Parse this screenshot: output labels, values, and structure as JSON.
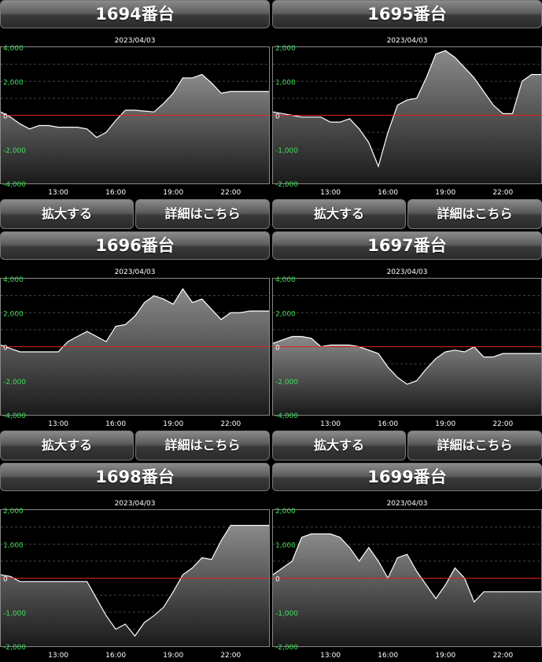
{
  "buttons": {
    "zoom": "拡大する",
    "detail": "詳細はこちら"
  },
  "colors": {
    "zero_line": "#e02020",
    "series_line": "#ffffff",
    "y_label_pos": "#3fe05a",
    "y_label_zero": "#ffffff",
    "grid": "#444444",
    "border": "#888888"
  },
  "chart_data": [
    {
      "type": "area",
      "title": "1694番台",
      "subtitle": "2023/04/03",
      "x_ticks": [
        "13:00",
        "16:00",
        "19:00",
        "22:00"
      ],
      "y_ticks": [
        "4,000",
        "2,000",
        "0",
        "-2,000",
        "-4,000"
      ],
      "ylim": [
        -4000,
        4000
      ],
      "x": [
        10,
        10.5,
        11,
        11.5,
        12,
        12.5,
        13,
        13.5,
        14,
        14.5,
        15,
        15.5,
        16,
        16.5,
        17,
        17.5,
        18,
        18.5,
        19,
        19.5,
        20,
        20.5,
        21,
        21.5,
        22,
        22.5,
        23,
        23.5,
        24
      ],
      "values": [
        200,
        -100,
        -500,
        -800,
        -600,
        -600,
        -700,
        -700,
        -700,
        -800,
        -1300,
        -1000,
        -300,
        300,
        300,
        250,
        200,
        700,
        1300,
        2200,
        2200,
        2400,
        1900,
        1300,
        1400,
        1400,
        1400,
        1400,
        1400
      ]
    },
    {
      "type": "area",
      "title": "1695番台",
      "subtitle": "2023/04/03",
      "x_ticks": [
        "13:00",
        "16:00",
        "19:00",
        "22:00"
      ],
      "y_ticks": [
        "2,000",
        "1,000",
        "0",
        "-1,000",
        "-2,000"
      ],
      "ylim": [
        -2000,
        2000
      ],
      "x": [
        10,
        10.5,
        11,
        11.5,
        12,
        12.5,
        13,
        13.5,
        14,
        14.5,
        15,
        15.5,
        16,
        16.5,
        17,
        17.5,
        18,
        18.5,
        19,
        19.5,
        20,
        20.5,
        21,
        21.5,
        22,
        22.5,
        23,
        23.5,
        24
      ],
      "values": [
        100,
        50,
        0,
        -50,
        -50,
        -50,
        -200,
        -200,
        -100,
        -400,
        -800,
        -1500,
        -500,
        300,
        450,
        500,
        1100,
        1800,
        1900,
        1700,
        1400,
        1100,
        700,
        300,
        50,
        50,
        1000,
        1200,
        1200
      ]
    },
    {
      "type": "area",
      "title": "1696番台",
      "subtitle": "2023/04/03",
      "x_ticks": [
        "13:00",
        "16:00",
        "19:00",
        "22:00"
      ],
      "y_ticks": [
        "4,000",
        "2,000",
        "0",
        "-2,000",
        "-4,000"
      ],
      "ylim": [
        -4000,
        4000
      ],
      "x": [
        10,
        10.5,
        11,
        11.5,
        12,
        12.5,
        13,
        13.5,
        14,
        14.5,
        15,
        15.5,
        16,
        16.5,
        17,
        17.5,
        18,
        18.5,
        19,
        19.5,
        20,
        20.5,
        21,
        21.5,
        22,
        22.5,
        23,
        23.5,
        24
      ],
      "values": [
        100,
        -100,
        -300,
        -300,
        -300,
        -300,
        -300,
        300,
        600,
        900,
        600,
        300,
        1200,
        1300,
        1800,
        2600,
        3000,
        2800,
        2500,
        3400,
        2600,
        2800,
        2200,
        1600,
        2000,
        2000,
        2100,
        2100,
        2100
      ]
    },
    {
      "type": "area",
      "title": "1697番台",
      "subtitle": "2023/04/03",
      "x_ticks": [
        "13:00",
        "16:00",
        "19:00",
        "22:00"
      ],
      "y_ticks": [
        "4,000",
        "2,000",
        "0",
        "-2,000",
        "-4,000"
      ],
      "ylim": [
        -4000,
        4000
      ],
      "x": [
        10,
        10.5,
        11,
        11.5,
        12,
        12.5,
        13,
        13.5,
        14,
        14.5,
        15,
        15.5,
        16,
        16.5,
        17,
        17.5,
        18,
        18.5,
        19,
        19.5,
        20,
        20.5,
        21,
        21.5,
        22,
        22.5,
        23,
        23.5,
        24
      ],
      "values": [
        200,
        400,
        600,
        600,
        500,
        0,
        100,
        100,
        100,
        0,
        -200,
        -400,
        -1200,
        -1800,
        -2200,
        -2000,
        -1300,
        -700,
        -300,
        -200,
        -300,
        0,
        -600,
        -600,
        -400,
        -400,
        -400,
        -400,
        -400
      ]
    },
    {
      "type": "area",
      "title": "1698番台",
      "subtitle": "2023/04/03",
      "x_ticks": [
        "13:00",
        "16:00",
        "19:00",
        "22:00"
      ],
      "y_ticks": [
        "2,000",
        "1,000",
        "0",
        "-1,000",
        "-2,000"
      ],
      "ylim": [
        -2000,
        2000
      ],
      "x": [
        10,
        10.5,
        11,
        11.5,
        12,
        12.5,
        13,
        13.5,
        14,
        14.5,
        15,
        15.5,
        16,
        16.5,
        17,
        17.5,
        18,
        18.5,
        19,
        19.5,
        20,
        20.5,
        21,
        21.5,
        22,
        22.5,
        23,
        23.5,
        24
      ],
      "values": [
        100,
        50,
        -100,
        -100,
        -100,
        -100,
        -100,
        -100,
        -100,
        -100,
        -600,
        -1100,
        -1500,
        -1350,
        -1700,
        -1300,
        -1100,
        -850,
        -400,
        100,
        300,
        600,
        550,
        1100,
        1550,
        1550,
        1550,
        1550,
        1550
      ]
    },
    {
      "type": "area",
      "title": "1699番台",
      "subtitle": "2023/04/03",
      "x_ticks": [
        "13:00",
        "16:00",
        "19:00",
        "22:00"
      ],
      "y_ticks": [
        "2,000",
        "1,000",
        "0",
        "-1,000",
        "-2,000"
      ],
      "ylim": [
        -2000,
        2000
      ],
      "x": [
        10,
        10.5,
        11,
        11.5,
        12,
        12.5,
        13,
        13.5,
        14,
        14.5,
        15,
        15.5,
        16,
        16.5,
        17,
        17.5,
        18,
        18.5,
        19,
        19.5,
        20,
        20.5,
        21,
        21.5,
        22,
        22.5,
        23,
        23.5,
        24
      ],
      "values": [
        100,
        300,
        500,
        1200,
        1300,
        1300,
        1300,
        1200,
        900,
        500,
        900,
        500,
        0,
        600,
        700,
        200,
        -200,
        -600,
        -200,
        300,
        0,
        -700,
        -400,
        -400,
        -400,
        -400,
        -400,
        -400,
        -400
      ]
    }
  ]
}
